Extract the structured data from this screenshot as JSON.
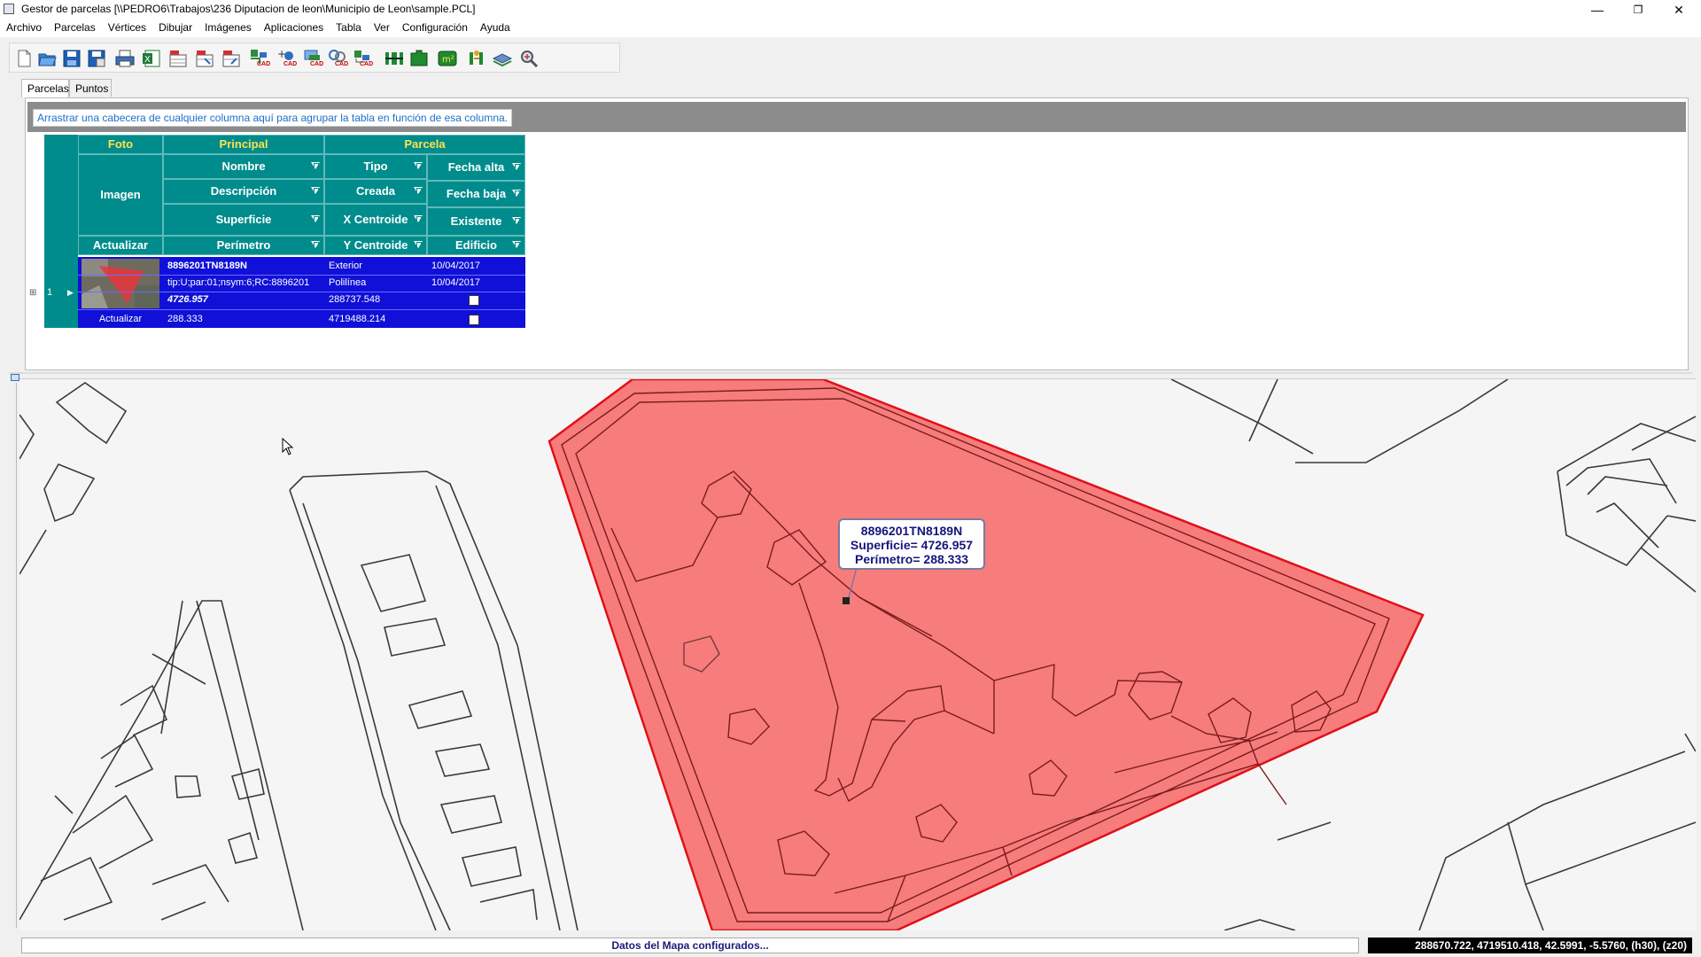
{
  "window": {
    "title": "Gestor de parcelas [\\\\PEDRO6\\Trabajos\\236 Diputacion de leon\\Municipio de Leon\\sample.PCL]",
    "minimize": "—",
    "maximize": "❐",
    "close": "✕"
  },
  "menu": [
    "Archivo",
    "Parcelas",
    "Vértices",
    "Dibujar",
    "Imágenes",
    "Aplicaciones",
    "Tabla",
    "Ver",
    "Configuración",
    "Ayuda"
  ],
  "toolbar": {
    "icons": [
      "new-file-icon",
      "open-file-icon",
      "save-icon",
      "save-as-icon",
      "print-icon",
      "excel-icon",
      "import-gml-icon",
      "import-shp-icon",
      "export-shp-icon",
      "cad-export-icon",
      "cad-add-icon",
      "cad-image-icon",
      "cad-link-icon",
      "cad-measure-icon",
      "vertex-tool-icon",
      "parcel-tool-icon",
      "area-tool-icon",
      "split-tool-icon",
      "layers-icon",
      "zoom-tool-icon"
    ],
    "cad_label": "CAD"
  },
  "tabs": [
    {
      "label": "Parcelas",
      "active": true
    },
    {
      "label": "Puntos",
      "active": false
    }
  ],
  "grid": {
    "group_hint": "Arrastrar una cabecera de cualquier columna aquí para agrupar la tabla en función de esa columna.",
    "bands": {
      "foto": "Foto",
      "principal": "Principal",
      "parcela": "Parcela"
    },
    "columns": {
      "imagen": "Imagen",
      "actualizar": "Actualizar",
      "nombre": "Nombre",
      "descripcion": "Descripción",
      "superficie": "Superficie",
      "perimetro": "Perímetro",
      "tipo": "Tipo",
      "creada": "Creada",
      "x_centroide": "X Centroide",
      "y_centroide": "Y Centroide",
      "fecha_alta": "Fecha alta",
      "fecha_baja": "Fecha baja",
      "existente": "Existente",
      "edificio": "Edificio"
    },
    "row": {
      "index": "1",
      "expander": "⊞",
      "pointer": "▶",
      "nombre": "8896201TN8189N",
      "descripcion": "tip:U;par:01;nsym:6;RC:8896201",
      "superficie": "4726.957",
      "perimetro": "288.333",
      "actualizar": "Actualizar",
      "tipo": "Exterior",
      "creada": "Polilínea",
      "x_centroide": "288737.548",
      "y_centroide": "4719488.214",
      "fecha_alta": "10/04/2017",
      "fecha_baja": "10/04/2017",
      "existente_checked": false,
      "edificio_checked": false
    }
  },
  "map": {
    "tooltip": {
      "line1": "8896201TN8189N",
      "line2": "Superficie= 4726.957",
      "line3": "Perímetro= 288.333"
    },
    "highlight_color": "#f77c7c",
    "highlight_stroke": "#e0101a"
  },
  "status": {
    "message": "Datos del Mapa configurados...",
    "coords": "288670.722, 4719510.418, 42.5991, -5.5760, (h30), (z20)"
  }
}
